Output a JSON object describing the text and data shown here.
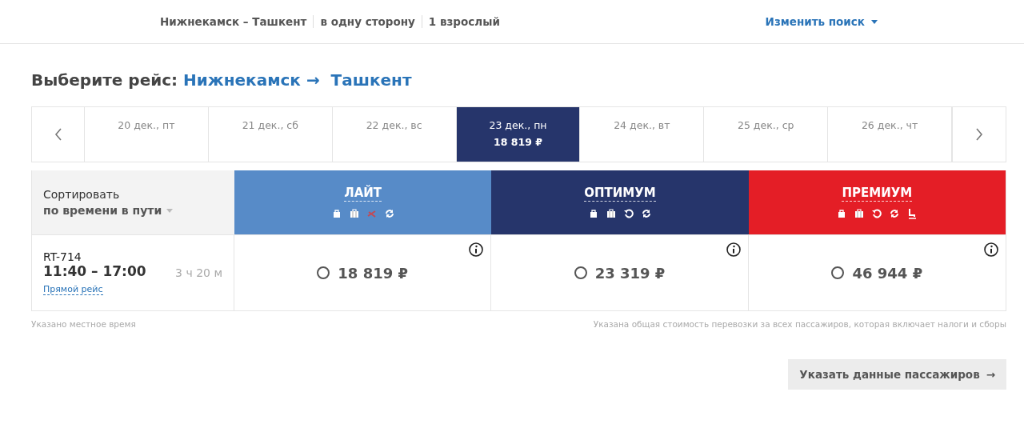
{
  "summary": {
    "route": "Нижнекамск – Ташкент",
    "trip": "в одну сторону",
    "passengers": "1 взрослый",
    "change_search": "Изменить поиск"
  },
  "heading": {
    "label": "Выберите рейс:",
    "from": "Нижнекамск",
    "arrow": "→",
    "to": "Ташкент"
  },
  "dates": [
    {
      "label": "20 дек., пт",
      "selected": false
    },
    {
      "label": "21 дек., сб",
      "selected": false
    },
    {
      "label": "22 дек., вс",
      "selected": false
    },
    {
      "label": "23 дек., пн",
      "price": "18 819 ₽",
      "selected": true
    },
    {
      "label": "24 дек., вт",
      "selected": false
    },
    {
      "label": "25 дек., ср",
      "selected": false
    },
    {
      "label": "26 дек., чт",
      "selected": false
    }
  ],
  "sort": {
    "label": "Сортировать",
    "value": "по времени в пути"
  },
  "fares": [
    {
      "name": "ЛАЙТ",
      "color": "#578bc8",
      "features": [
        {
          "kind": "bag",
          "included": true
        },
        {
          "kind": "luggage",
          "included": true
        },
        {
          "kind": "refund",
          "included": false
        },
        {
          "kind": "exchange",
          "included": true
        }
      ]
    },
    {
      "name": "ОПТИМУМ",
      "color": "#26356b",
      "features": [
        {
          "kind": "bag",
          "included": true
        },
        {
          "kind": "luggage",
          "included": true
        },
        {
          "kind": "refund",
          "included": true
        },
        {
          "kind": "exchange",
          "included": true
        }
      ]
    },
    {
      "name": "ПРЕМИУМ",
      "color": "#e41e26",
      "features": [
        {
          "kind": "bag",
          "included": true
        },
        {
          "kind": "luggage",
          "included": true
        },
        {
          "kind": "refund",
          "included": true
        },
        {
          "kind": "exchange",
          "included": true
        },
        {
          "kind": "seat",
          "included": true
        }
      ]
    }
  ],
  "flights": [
    {
      "number": "RT-714",
      "time": "11:40 – 17:00",
      "duration": "3 ч 20 м",
      "type": "Прямой рейс",
      "prices": [
        {
          "price": "18 819 ₽",
          "selected": false
        },
        {
          "price": "23 319 ₽",
          "selected": false
        },
        {
          "price": "46 944 ₽",
          "selected": false
        }
      ]
    }
  ],
  "notes": {
    "left": "Указано местное время",
    "right": "Указана общая стоимость перевозки за всех пассажиров, которая включает налоги и сборы"
  },
  "next_button": {
    "label": "Указать данные пассажиров",
    "arrow": "→"
  }
}
